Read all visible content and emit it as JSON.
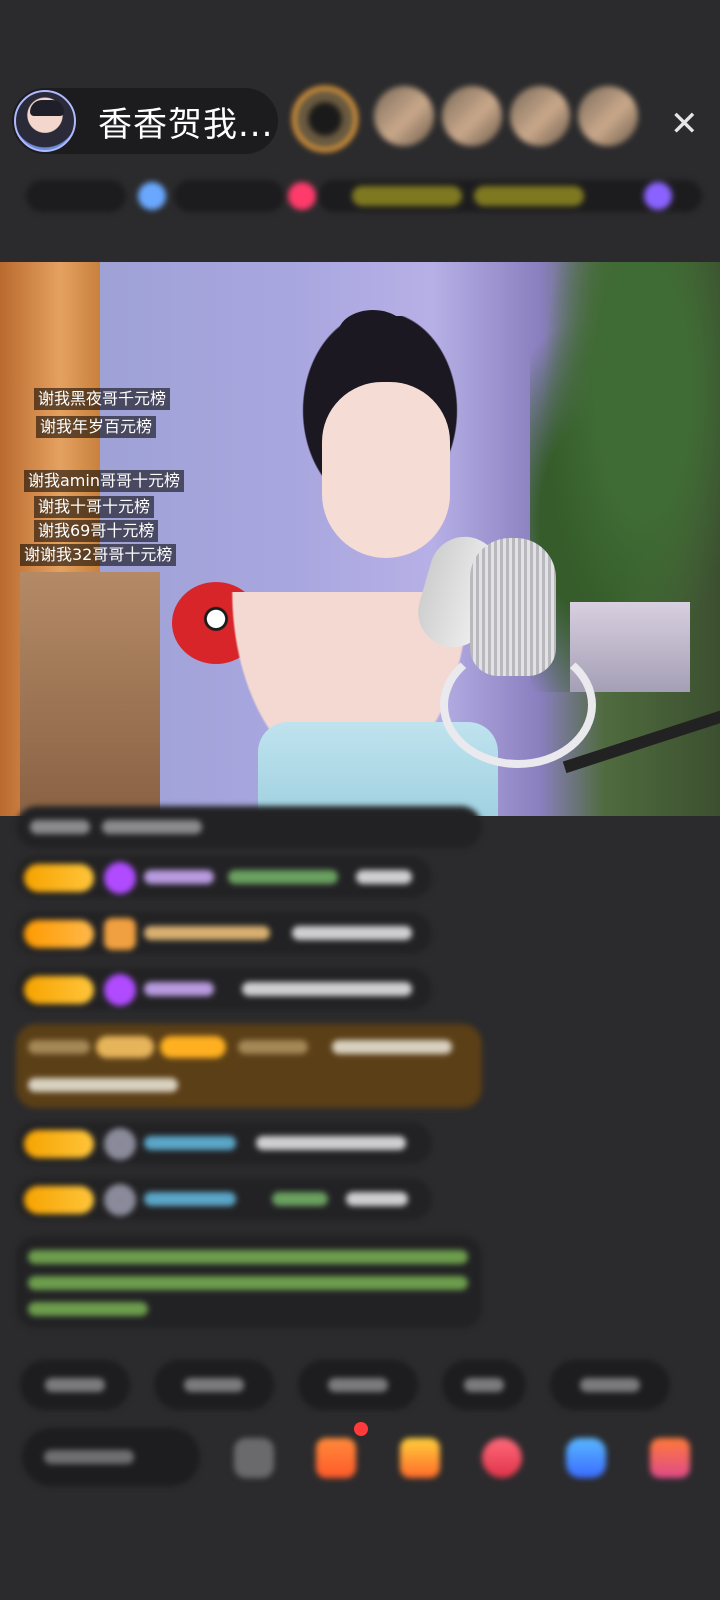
{
  "header": {
    "host_name": "香香贺我..."
  },
  "stream": {
    "thanks_messages": [
      "谢我黑夜哥千元榜",
      "谢我年岁百元榜",
      "谢我amin哥哥十元榜",
      "谢我十哥十元榜",
      "谢我69哥十元榜",
      "谢谢我32哥哥十元榜"
    ]
  },
  "colors": {
    "background": "#2b2b2d",
    "badge_gold": "#f6a300",
    "gift_brown_message": "#5b3f16"
  },
  "icons": [
    "close-icon",
    "emoji-icon",
    "gift-icon",
    "heart-icon",
    "game-icon",
    "box-icon"
  ]
}
